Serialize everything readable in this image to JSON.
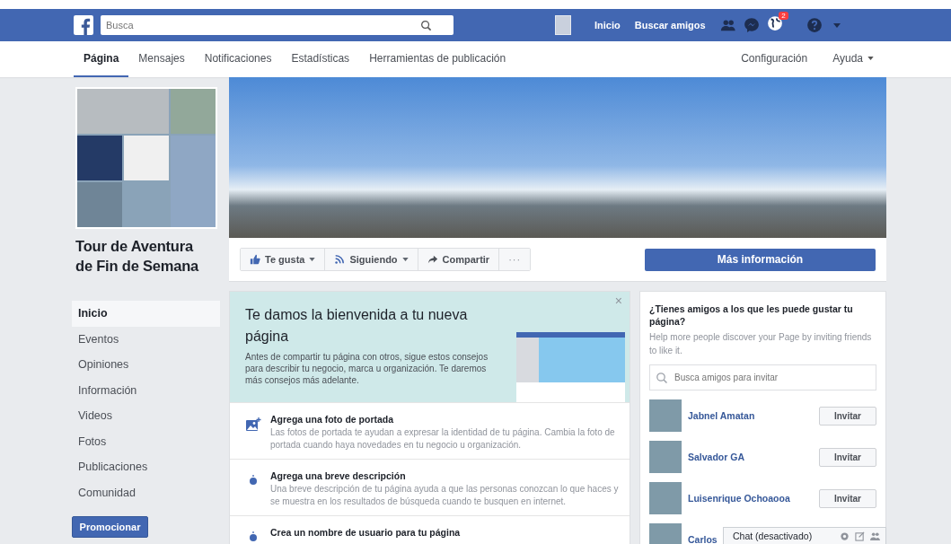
{
  "header": {
    "search_placeholder": "Busca",
    "links": [
      "Inicio",
      "Buscar amigos"
    ],
    "notification_count": "2"
  },
  "nav": {
    "tabs": [
      {
        "label": "Página",
        "selected": true
      },
      {
        "label": "Mensajes",
        "selected": false
      },
      {
        "label": "Notificaciones",
        "selected": false
      },
      {
        "label": "Estadísticas",
        "selected": false
      },
      {
        "label": "Herramientas de publicación",
        "selected": false
      }
    ],
    "right": [
      "Configuración",
      "Ayuda"
    ]
  },
  "page_name": "Tour de Aventura de Fin de Semana",
  "sidebar": {
    "items": [
      {
        "label": "Inicio",
        "selected": true
      },
      {
        "label": "Eventos",
        "selected": false
      },
      {
        "label": "Opiniones",
        "selected": false
      },
      {
        "label": "Información",
        "selected": false
      },
      {
        "label": "Videos",
        "selected": false
      },
      {
        "label": "Fotos",
        "selected": false
      },
      {
        "label": "Publicaciones",
        "selected": false
      },
      {
        "label": "Comunidad",
        "selected": false
      }
    ],
    "promote_button": "Promocionar"
  },
  "actions": [
    {
      "kind": "like",
      "label": "Te gusta",
      "dropdown": true
    },
    {
      "kind": "follow",
      "label": "Siguiendo",
      "dropdown": true
    },
    {
      "kind": "share",
      "label": "Compartir",
      "dropdown": false
    },
    {
      "kind": "more",
      "label": "···",
      "dropdown": false
    }
  ],
  "more_info_button": "Más información",
  "welcome": {
    "title": "Te damos la bienvenida a tu nueva página",
    "text": "Antes de compartir tu página con otros, sigue estos consejos para describir tu negocio, marca u organización. Te daremos más consejos más adelante.",
    "close": "×"
  },
  "tasks": [
    {
      "kind": "photo",
      "title": "Agrega una foto de portada",
      "text": "Las fotos de portada te ayudan a expresar la identidad de tu página. Cambia la foto de portada cuando haya novedades en tu negocio u organización."
    },
    {
      "kind": "tip",
      "title": "Agrega una breve descripción",
      "text": "Una breve descripción de tu página ayuda a que las personas conozcan lo que haces y se muestra en los resultados de búsqueda cuando te busquen en internet."
    },
    {
      "kind": "tip",
      "title": "Crea un nombre de usuario para tu página"
    }
  ],
  "invite": {
    "title": "¿Tienes amigos a los que les puede gustar tu página?",
    "text": "Help more people discover your Page by inviting friends to like it.",
    "search_placeholder": "Busca amigos para invitar",
    "friends": [
      {
        "name": "Jabnel Amatan",
        "button": "Invitar"
      },
      {
        "name": "Salvador GA",
        "button": "Invitar"
      },
      {
        "name": "Luisenrique Ochoaooa",
        "button": "Invitar"
      },
      {
        "name": "Carlos"
      }
    ]
  },
  "chat": {
    "label": "Chat (desactivado)"
  }
}
